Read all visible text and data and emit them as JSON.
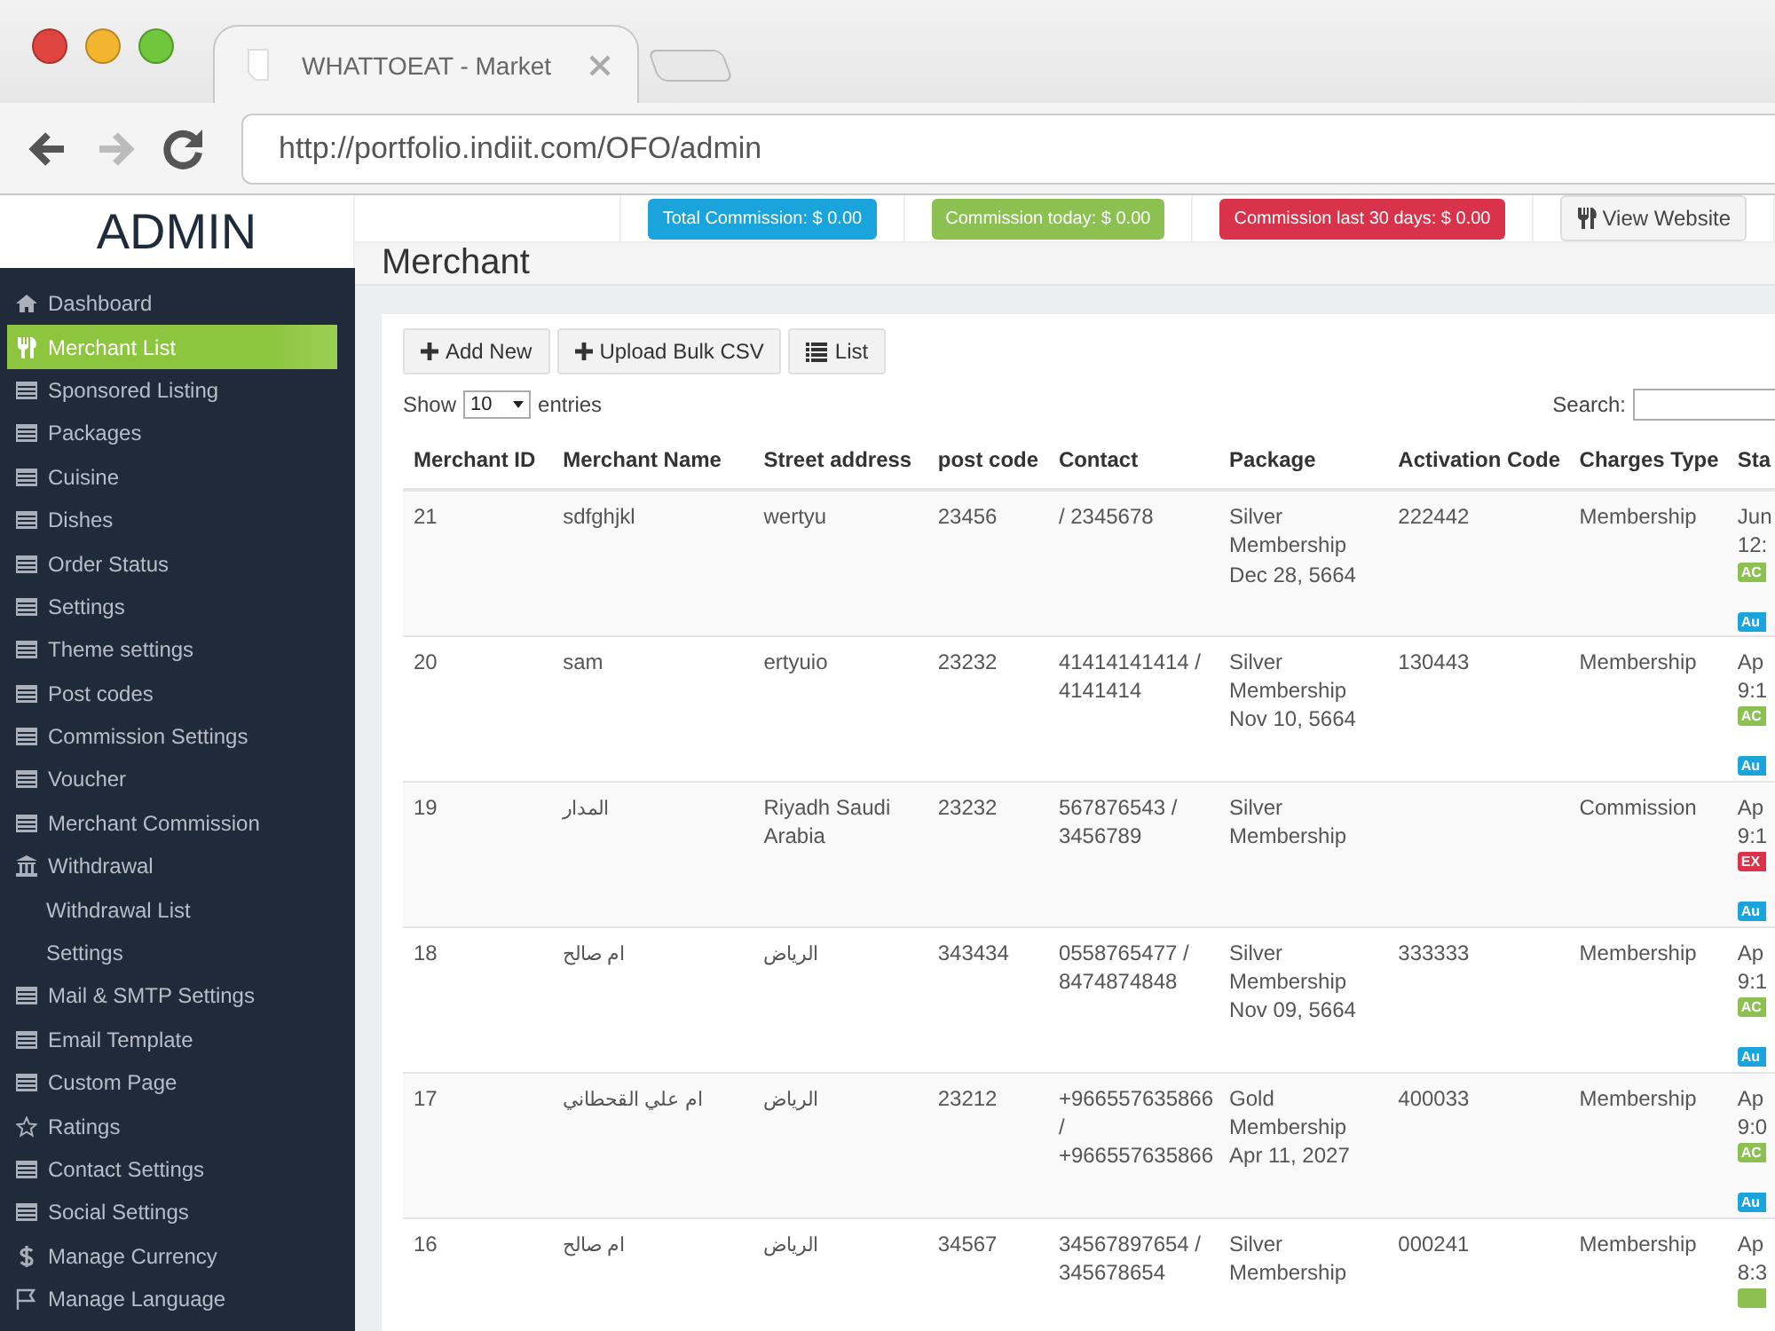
{
  "browser": {
    "tab_title": "WHATTOEAT - Market",
    "url": "http://portfolio.indiit.com/OFO/admin"
  },
  "sidebar": {
    "brand": "ADMIN",
    "items": [
      {
        "label": "Dashboard",
        "kind": "home",
        "selected": false
      },
      {
        "label": "Merchant List",
        "kind": "cutlery",
        "selected": true
      },
      {
        "label": "Sponsored Listing",
        "kind": "table",
        "selected": false
      },
      {
        "label": "Packages",
        "kind": "table",
        "selected": false
      },
      {
        "label": "Cuisine",
        "kind": "table",
        "selected": false
      },
      {
        "label": "Dishes",
        "kind": "table",
        "selected": false
      },
      {
        "label": "Order Status",
        "kind": "table",
        "selected": false
      },
      {
        "label": "Settings",
        "kind": "table",
        "selected": false
      },
      {
        "label": "Theme settings",
        "kind": "table",
        "selected": false
      },
      {
        "label": "Post codes",
        "kind": "table",
        "selected": false
      },
      {
        "label": "Commission Settings",
        "kind": "table",
        "selected": false
      },
      {
        "label": "Voucher",
        "kind": "table",
        "selected": false
      },
      {
        "label": "Merchant Commission",
        "kind": "table",
        "selected": false
      },
      {
        "label": "Withdrawal",
        "kind": "bank",
        "selected": false,
        "children": [
          {
            "label": "Withdrawal List",
            "selected": false
          },
          {
            "label": "Settings",
            "selected": false
          }
        ]
      },
      {
        "label": "Mail & SMTP Settings",
        "kind": "table",
        "selected": false
      },
      {
        "label": "Email Template",
        "kind": "table",
        "selected": false
      },
      {
        "label": "Custom Page",
        "kind": "table",
        "selected": false
      },
      {
        "label": "Ratings",
        "kind": "star",
        "selected": false
      },
      {
        "label": "Contact Settings",
        "kind": "table",
        "selected": false
      },
      {
        "label": "Social Settings",
        "kind": "table",
        "selected": false
      },
      {
        "label": "Manage Currency",
        "kind": "dollar",
        "selected": false
      },
      {
        "label": "Manage Language",
        "kind": "flag",
        "selected": false
      }
    ]
  },
  "top_bar": {
    "badges": [
      {
        "text": "Total Commission: $ 0.00",
        "color": "#1ba4dc"
      },
      {
        "text": "Commission today: $ 0.00",
        "color": "#8cc152"
      },
      {
        "text": "Commission last 30 days: $ 0.00",
        "color": "#d8334a"
      }
    ],
    "view_website": "View Website"
  },
  "page_title": "Merchant",
  "toolbar": [
    {
      "label": "Add New",
      "kind": "plus"
    },
    {
      "label": "Upload Bulk CSV",
      "kind": "plus"
    },
    {
      "label": "List",
      "kind": "list"
    }
  ],
  "length_menu": {
    "label": "Show",
    "value": "10",
    "suffix": "entries"
  },
  "search": {
    "label": "Search:"
  },
  "table": {
    "columns": [
      "Merchant ID",
      "Merchant Name",
      "Street address",
      "post code",
      "Contact",
      "Package",
      "Activation Code",
      "Charges Type",
      "Sta"
    ],
    "rows": [
      {
        "cells": [
          "21",
          "sdfghjkl",
          "wertyu",
          "23456",
          "/ 2345678",
          "Silver Membership\nDec 28, 5664",
          "222442",
          "Membership"
        ],
        "status": {
          "lines": [
            "Jun",
            "12:"
          ],
          "badges": [
            {
              "text": "AC",
              "color": "#8cc152"
            },
            {
              "text": "Au",
              "color": "#1ba4dc"
            }
          ]
        }
      },
      {
        "cells": [
          "20",
          "sam",
          "ertyuio",
          "23232",
          "41414141414 / 4141414",
          "Silver Membership\nNov 10, 5664",
          "130443",
          "Membership"
        ],
        "status": {
          "lines": [
            "Ap",
            "9:1"
          ],
          "badges": [
            {
              "text": "AC",
              "color": "#8cc152"
            },
            {
              "text": "Au",
              "color": "#1ba4dc"
            }
          ]
        }
      },
      {
        "cells": [
          "19",
          "المدار",
          "Riyadh Saudi Arabia",
          "23232",
          "567876543 / 3456789",
          "Silver Membership",
          "",
          "Commission"
        ],
        "status": {
          "lines": [
            "Ap",
            "9:1"
          ],
          "badges": [
            {
              "text": "EX",
              "color": "#d8334a"
            },
            {
              "text": "Au",
              "color": "#1ba4dc"
            }
          ]
        }
      },
      {
        "cells": [
          "18",
          "ام صالح",
          "الرياض",
          "343434",
          "0558765477 / 8474874848",
          "Silver Membership\nNov 09, 5664",
          "333333",
          "Membership"
        ],
        "status": {
          "lines": [
            "Ap",
            "9:1"
          ],
          "badges": [
            {
              "text": "AC",
              "color": "#8cc152"
            },
            {
              "text": "Au",
              "color": "#1ba4dc"
            }
          ]
        }
      },
      {
        "cells": [
          "17",
          "ام علي القحطاني",
          "الرياض",
          "23212",
          "+966557635866 / +966557635866",
          "Gold Membership\nApr 11, 2027",
          "400033",
          "Membership"
        ],
        "status": {
          "lines": [
            "Ap",
            "9:0"
          ],
          "badges": [
            {
              "text": "AC",
              "color": "#8cc152"
            },
            {
              "text": "Au",
              "color": "#1ba4dc"
            }
          ]
        }
      },
      {
        "cells": [
          "16",
          "ام صالح",
          "الرياض",
          "34567",
          "34567897654 / 345678654",
          "Silver Membership",
          "000241",
          "Membership"
        ],
        "status": {
          "lines": [
            "Ap",
            "8:3"
          ],
          "badges": [
            {
              "color": "#8cc152"
            }
          ]
        }
      }
    ]
  }
}
